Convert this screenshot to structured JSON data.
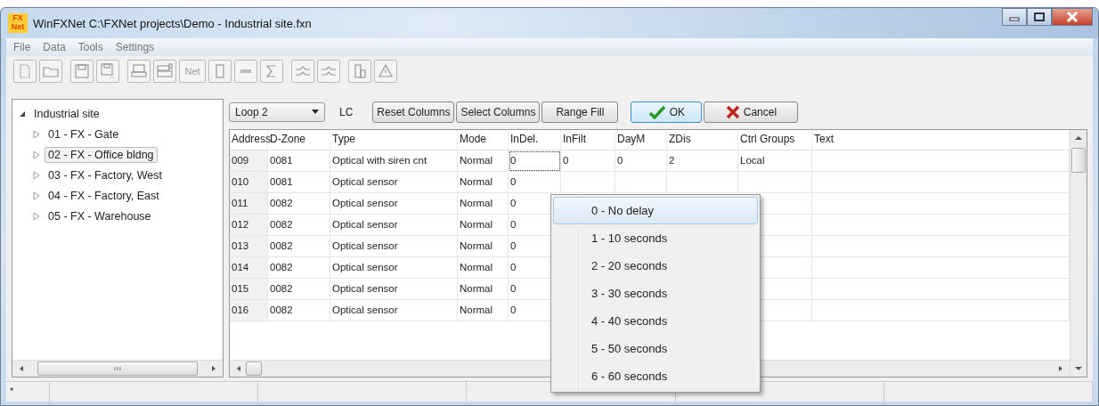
{
  "window": {
    "title": "WinFXNet C:\\FXNet projects\\Demo - Industrial site.fxn",
    "app_icon_text": "FX\nNet"
  },
  "menu": [
    "File",
    "Data",
    "Tools",
    "Settings"
  ],
  "toolbar": {
    "net_label": "Net"
  },
  "tree": {
    "label": "Industrial site",
    "expanded": true,
    "children": [
      {
        "label": "01 - FX - Gate",
        "selected": false
      },
      {
        "label": "02 - FX - Office bldng",
        "selected": true
      },
      {
        "label": "03 - FX - Factory, West",
        "selected": false
      },
      {
        "label": "04 - FX - Factory, East",
        "selected": false
      },
      {
        "label": "05 - FX - Warehouse",
        "selected": false
      }
    ]
  },
  "loop_select": {
    "value": "Loop 2"
  },
  "lc_label": "LC",
  "buttons": [
    {
      "label": "Reset Columns",
      "kind": "plain"
    },
    {
      "label": "Select Columns",
      "kind": "plain"
    },
    {
      "label": "Range Fill",
      "kind": "plain"
    },
    {
      "label": "OK",
      "kind": "ok"
    },
    {
      "label": "Cancel",
      "kind": "cancel"
    }
  ],
  "table": {
    "columns": [
      "Address",
      "D-Zone",
      "Type",
      "Mode",
      "InDel.",
      "InFilt",
      "DayM",
      "ZDis",
      "Ctrl Groups",
      "Text"
    ],
    "rows": [
      [
        "009",
        "0081",
        "Optical with siren cnt",
        "Normal",
        "0",
        "0",
        "0",
        "2",
        "Local",
        ""
      ],
      [
        "010",
        "0081",
        "Optical sensor",
        "Normal",
        "0",
        "",
        "",
        "",
        "",
        ""
      ],
      [
        "011",
        "0082",
        "Optical sensor",
        "Normal",
        "0",
        "",
        "",
        "",
        "",
        ""
      ],
      [
        "012",
        "0082",
        "Optical sensor",
        "Normal",
        "0",
        "",
        "",
        "",
        "",
        ""
      ],
      [
        "013",
        "0082",
        "Optical sensor",
        "Normal",
        "0",
        "",
        "",
        "",
        "",
        ""
      ],
      [
        "014",
        "0082",
        "Optical sensor",
        "Normal",
        "0",
        "",
        "",
        "",
        "",
        ""
      ],
      [
        "015",
        "0082",
        "Optical sensor",
        "Normal",
        "0",
        "",
        "",
        "",
        "",
        ""
      ],
      [
        "016",
        "0082",
        "Optical sensor",
        "Normal",
        "0",
        "",
        "",
        "",
        "",
        ""
      ]
    ]
  },
  "dropdown_menu": [
    {
      "label": "0 - No delay",
      "selected": true
    },
    {
      "label": "1 - 10 seconds",
      "selected": false
    },
    {
      "label": "2 - 20 seconds",
      "selected": false
    },
    {
      "label": "3 - 30 seconds",
      "selected": false
    },
    {
      "label": "4 - 40 seconds",
      "selected": false
    },
    {
      "label": "5 - 50 seconds",
      "selected": false
    },
    {
      "label": "6 - 60 seconds",
      "selected": false
    }
  ],
  "status_bar": [
    "*"
  ]
}
